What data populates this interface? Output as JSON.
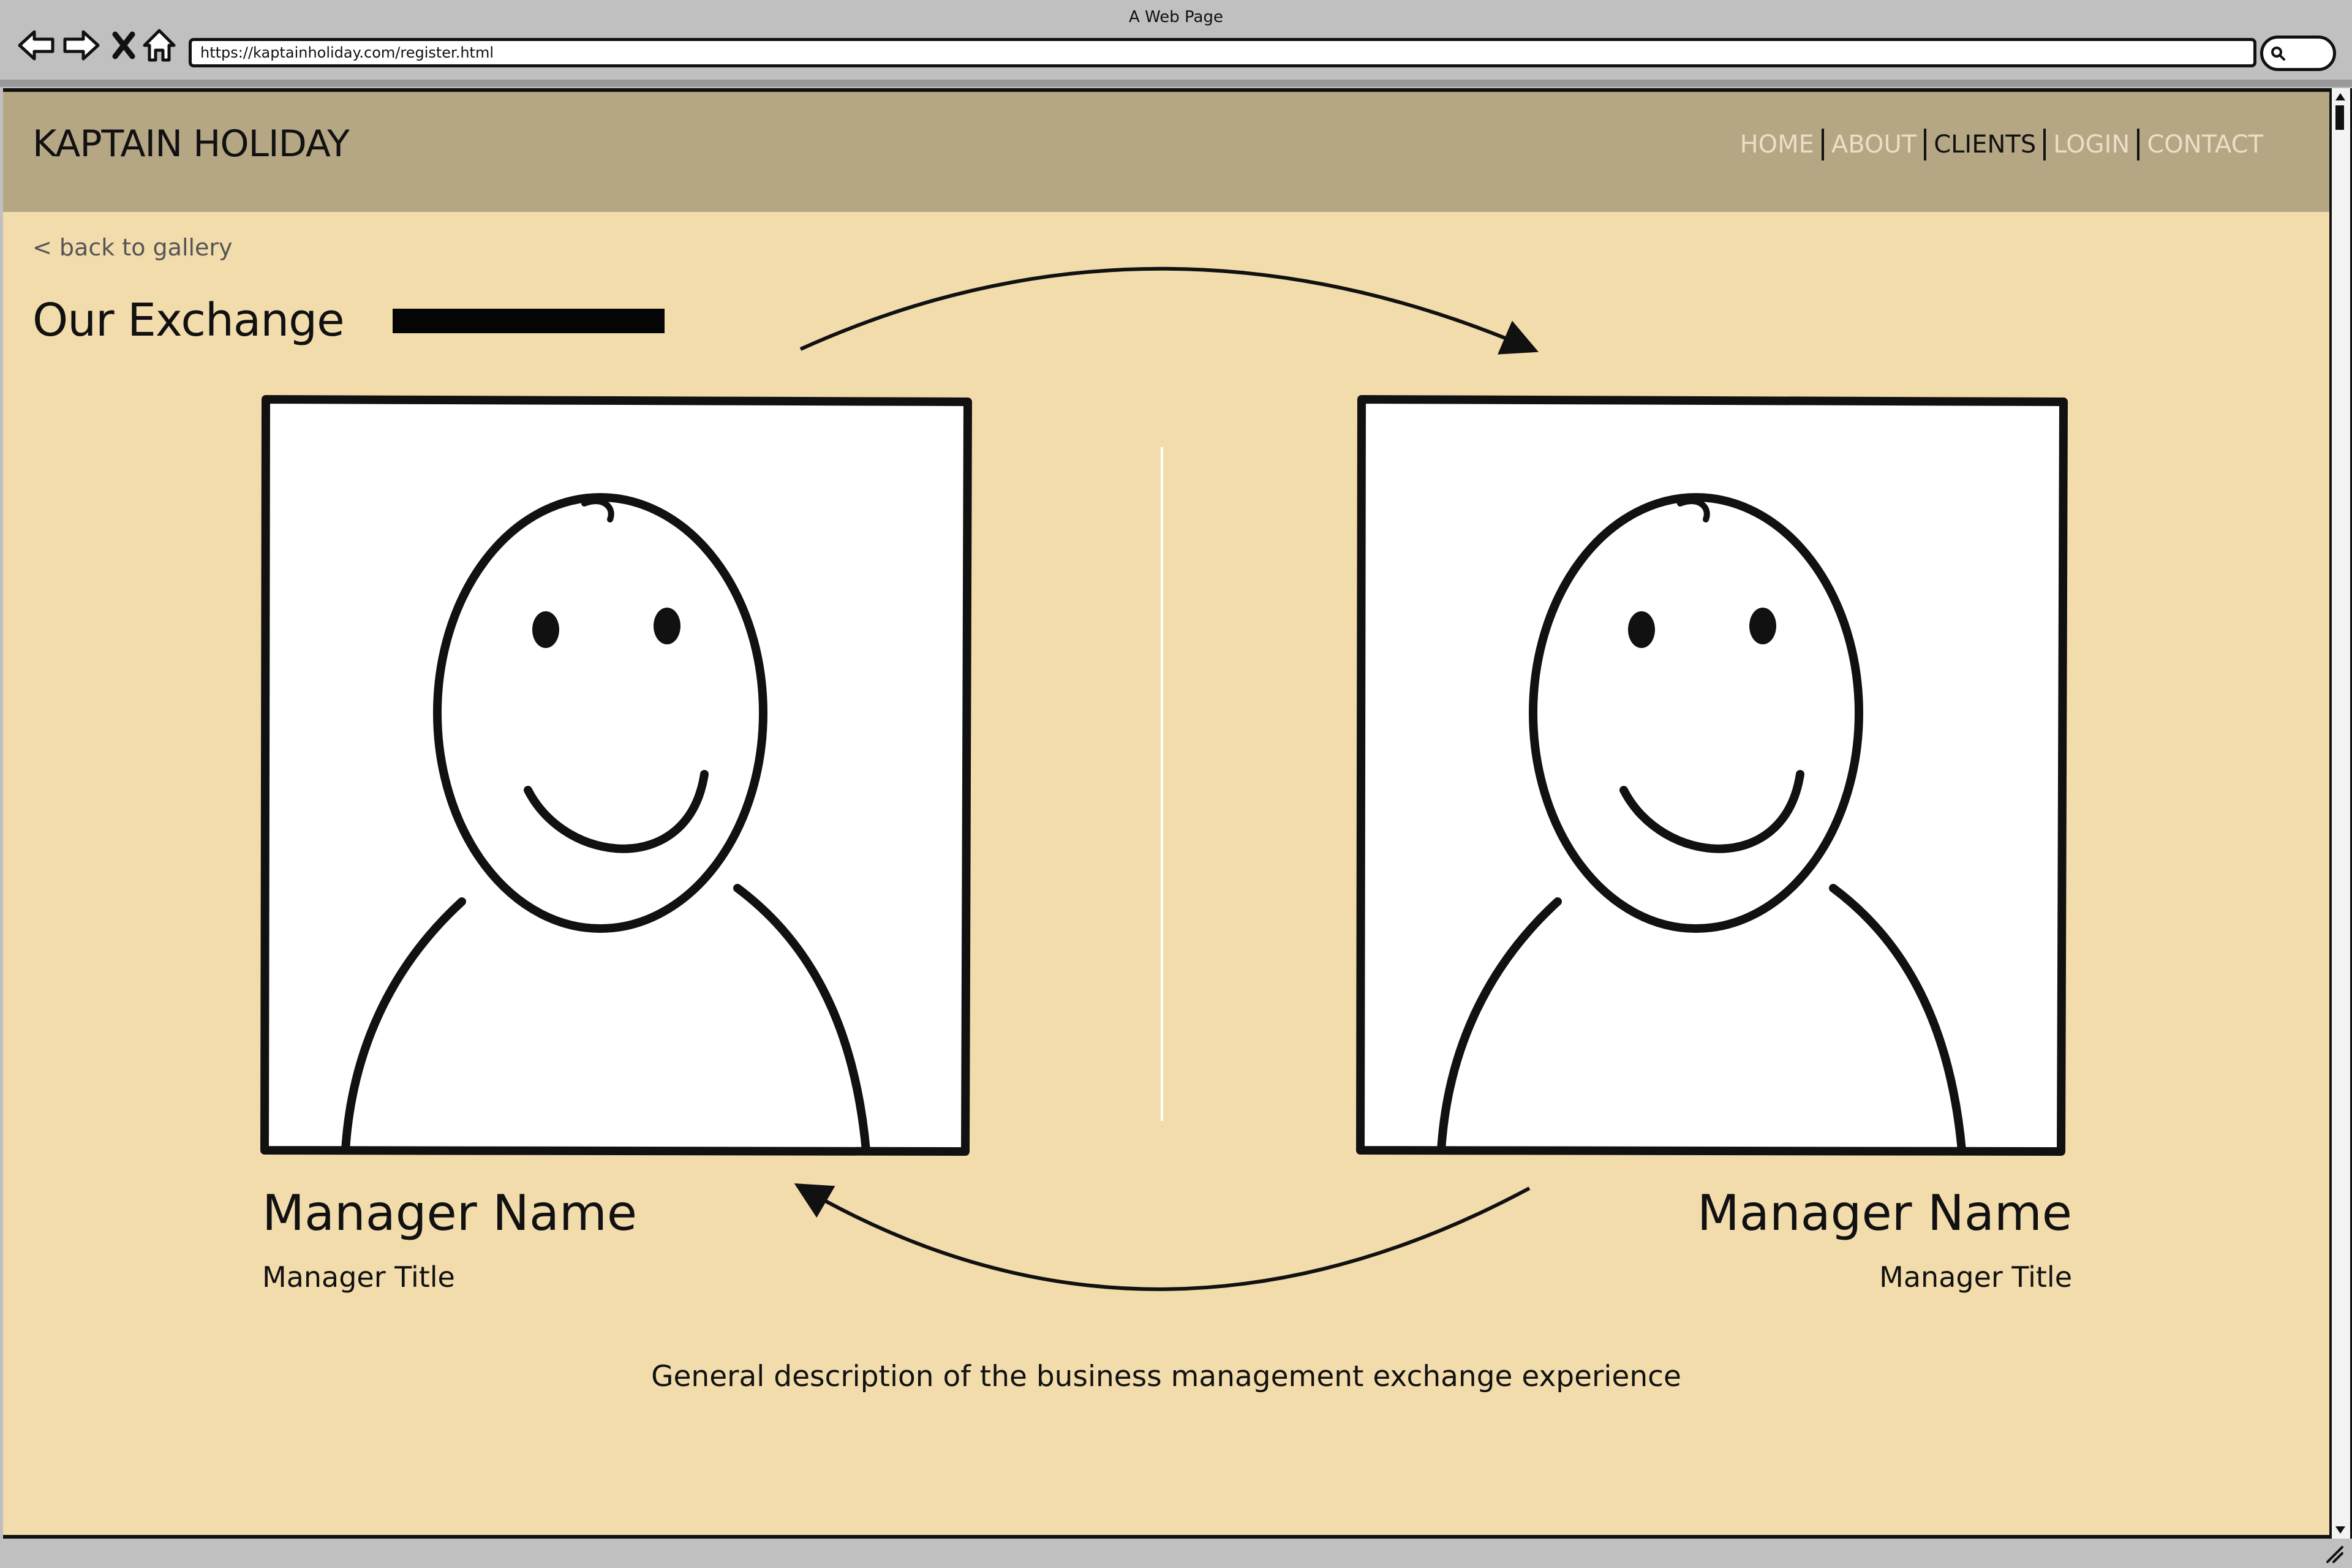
{
  "browser": {
    "window_title": "A Web Page",
    "url": "https://kaptainholiday.com/register.html",
    "icons": [
      "back-arrow-icon",
      "forward-arrow-icon",
      "close-x-icon",
      "home-icon",
      "search-icon"
    ]
  },
  "header": {
    "site_title": "KAPTAIN HOLIDAY",
    "nav": [
      {
        "label": "HOME",
        "active": false
      },
      {
        "label": "ABOUT",
        "active": false
      },
      {
        "label": "CLIENTS",
        "active": true
      },
      {
        "label": "LOGIN",
        "active": false
      },
      {
        "label": "CONTACT",
        "active": false
      }
    ]
  },
  "content": {
    "back_link": "< back to gallery",
    "heading": "Our Exchange",
    "left_manager": {
      "name": "Manager Name",
      "title": "Manager Title"
    },
    "right_manager": {
      "name": "Manager Name",
      "title": "Manager Title"
    },
    "description": "General description of the business management exchange experience"
  },
  "colors": {
    "page_background": "#f2dcac",
    "header_background": "#b5a684",
    "nav_inactive": "#eadfc6",
    "nav_active": "#111111",
    "chrome_gray": "#c0c0c0"
  }
}
